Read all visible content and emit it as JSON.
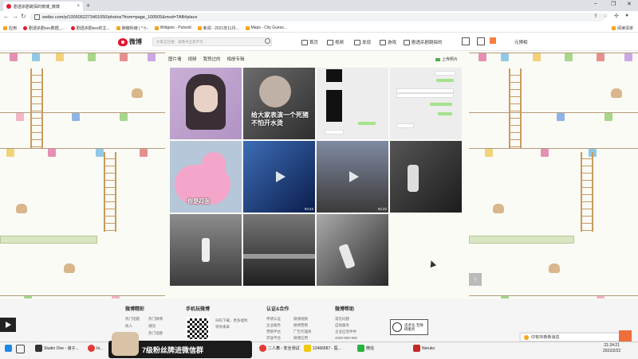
{
  "browser": {
    "tab_title": "剧透杀剧跳探的微博_微博",
    "url": "weibo.com/p/1005052273401050/photos?from=page_100505&mod=TAB#place",
    "bookmarks": [
      "应用",
      "剧透杀剧sex数据_...",
      "剧透杀剧sex的主...",
      "肿瘤科链 | ^ゥ-",
      "Widgets - Pulsoid",
      "新闻 - 2021年11月...",
      "Maps - City Guess..."
    ],
    "reading_list": "阅读清单"
  },
  "weibo_nav": {
    "logo": "微博",
    "search_placeholder": "大家正在搜：高铁中全息不可",
    "items": [
      "首页",
      "视频",
      "发现",
      "游戏",
      "剧透杀剧跳探的"
    ],
    "right_item": "元博相"
  },
  "photo_tabs": [
    "图片墙",
    "视频",
    "我赞过的",
    "相册专辑"
  ],
  "upload_label": "上传照片",
  "photos": [
    {
      "type": "photo"
    },
    {
      "type": "photo",
      "caption": "给大家表演一个死猪不怕开水烫"
    },
    {
      "type": "chat"
    },
    {
      "type": "chat"
    },
    {
      "type": "photo",
      "caption": "你是四张"
    },
    {
      "type": "video",
      "duration": "03:43"
    },
    {
      "type": "video",
      "duration": "02:22"
    },
    {
      "type": "photo"
    },
    {
      "type": "photo"
    },
    {
      "type": "photo"
    },
    {
      "type": "photo"
    }
  ],
  "footer": {
    "col1_title": "微博精彩",
    "col1_links": [
      "热门话题",
      "热门微博",
      "找人",
      "潮流",
      "热门话题"
    ],
    "col2_title": "手机玩微博",
    "col2_links": [
      "扫码下载，更多福利",
      "等你来拿"
    ],
    "col3_title": "认证&合作",
    "col3_links": [
      "申请认证",
      "企业服务",
      "营销平台",
      "开放平台",
      "微博视频",
      "广告代理商",
      "微博营销",
      "微博应用"
    ],
    "col4_title": "微博帮助",
    "col4_links": [
      "常见问题",
      "自助服务",
      "企业应急件件",
      "4000-980-980"
    ],
    "a11y_label": "适老化 无障碍服务"
  },
  "private_msg": "仔有95条新消息",
  "banner": "7级粉丝牌进微信群",
  "taskbar": {
    "items": [
      "Studio One - 浪子...",
      "bi...",
      "二人舞 - 安全测试",
      "12466687 - 医...",
      "微信",
      "Neruko"
    ],
    "time": "21:24:21",
    "date": "2022/2/22"
  },
  "colors": {
    "weibo_red": "#e6162d",
    "accent_orange": "#fa7d3c"
  }
}
